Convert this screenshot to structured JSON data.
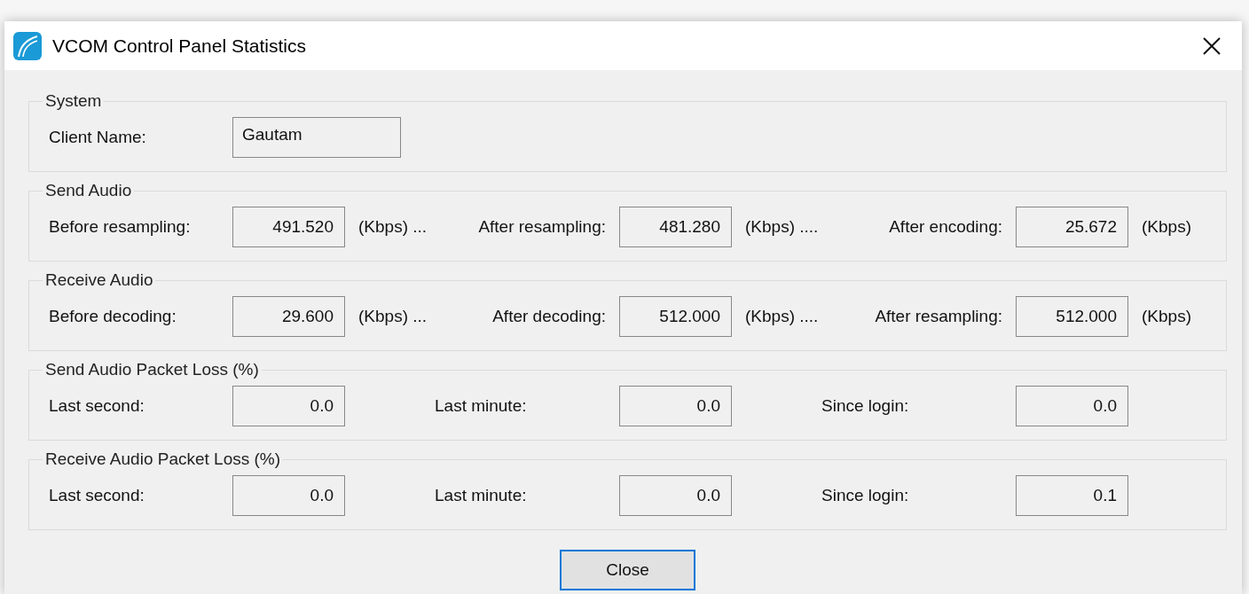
{
  "window": {
    "title": "VCOM Control Panel Statistics"
  },
  "groups": [
    {
      "title": "System",
      "items": [
        {
          "kind": "text",
          "label": "Client Name:",
          "value": "Gautam"
        }
      ]
    },
    {
      "title": "Send Audio",
      "items": [
        {
          "kind": "number",
          "label": "Before resampling:",
          "value": "491.520",
          "unit": "(Kbps) ..."
        },
        {
          "kind": "number",
          "label": "After resampling:",
          "value": "481.280",
          "unit": "(Kbps) ...."
        },
        {
          "kind": "number",
          "label": "After encoding:",
          "value": "25.672",
          "unit": "(Kbps)"
        }
      ]
    },
    {
      "title": "Receive Audio",
      "items": [
        {
          "kind": "number",
          "label": "Before decoding:",
          "value": "29.600",
          "unit": "(Kbps) ..."
        },
        {
          "kind": "number",
          "label": "After decoding:",
          "value": "512.000",
          "unit": "(Kbps) ...."
        },
        {
          "kind": "number",
          "label": "After resampling:",
          "value": "512.000",
          "unit": "(Kbps)"
        }
      ]
    },
    {
      "title": "Send Audio Packet Loss (%)",
      "items": [
        {
          "kind": "number",
          "label": "Last second:",
          "value": "0.0"
        },
        {
          "kind": "number",
          "label": "Last minute:",
          "value": "0.0"
        },
        {
          "kind": "number",
          "label": "Since login:",
          "value": "0.0"
        }
      ]
    },
    {
      "title": "Receive Audio Packet Loss (%)",
      "items": [
        {
          "kind": "number",
          "label": "Last second:",
          "value": "0.0"
        },
        {
          "kind": "number",
          "label": "Last minute:",
          "value": "0.0"
        },
        {
          "kind": "number",
          "label": "Since login:",
          "value": "0.1"
        }
      ]
    }
  ],
  "buttons": [
    "Close"
  ]
}
